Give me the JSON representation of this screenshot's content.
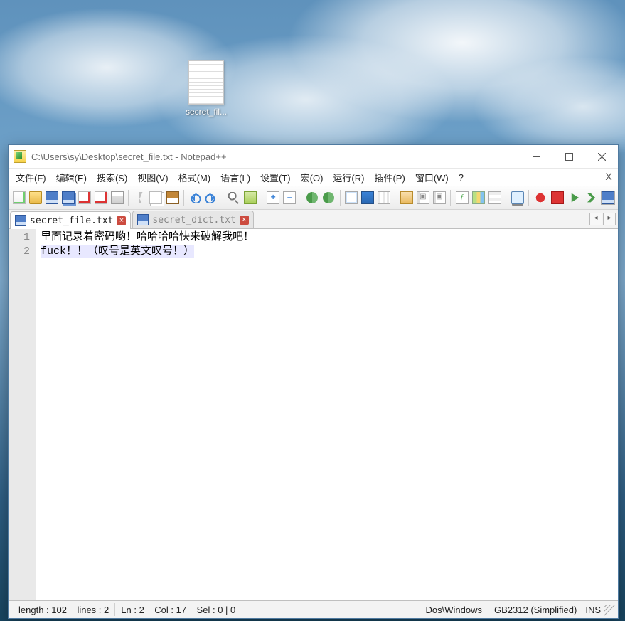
{
  "desktop": {
    "icon_label": "secret_fil..."
  },
  "window": {
    "title": "C:\\Users\\sy\\Desktop\\secret_file.txt - Notepad++"
  },
  "menu": {
    "file": "文件(F)",
    "edit": "编辑(E)",
    "search": "搜索(S)",
    "view": "视图(V)",
    "format": "格式(M)",
    "language": "语言(L)",
    "settings": "设置(T)",
    "macro": "宏(O)",
    "run": "运行(R)",
    "plugins": "插件(P)",
    "window": "窗口(W)",
    "help": "?"
  },
  "tabs": {
    "active": "secret_file.txt",
    "inactive": "secret_dict.txt"
  },
  "editor": {
    "gutter": {
      "l1": "1",
      "l2": "2"
    },
    "line1": "里面记录着密码哟！哈哈哈哈快来破解我吧！",
    "line2": "fuck！！（叹号是英文叹号！）"
  },
  "status": {
    "length_label": "length :",
    "length_value": "102",
    "lines_label": "lines :",
    "lines_value": "2",
    "ln_label": "Ln :",
    "ln_value": "2",
    "col_label": "Col :",
    "col_value": "17",
    "sel_label": "Sel :",
    "sel_value": "0 | 0",
    "eol": "Dos\\Windows",
    "enc": "GB2312 (Simplified)",
    "ins": "INS"
  }
}
